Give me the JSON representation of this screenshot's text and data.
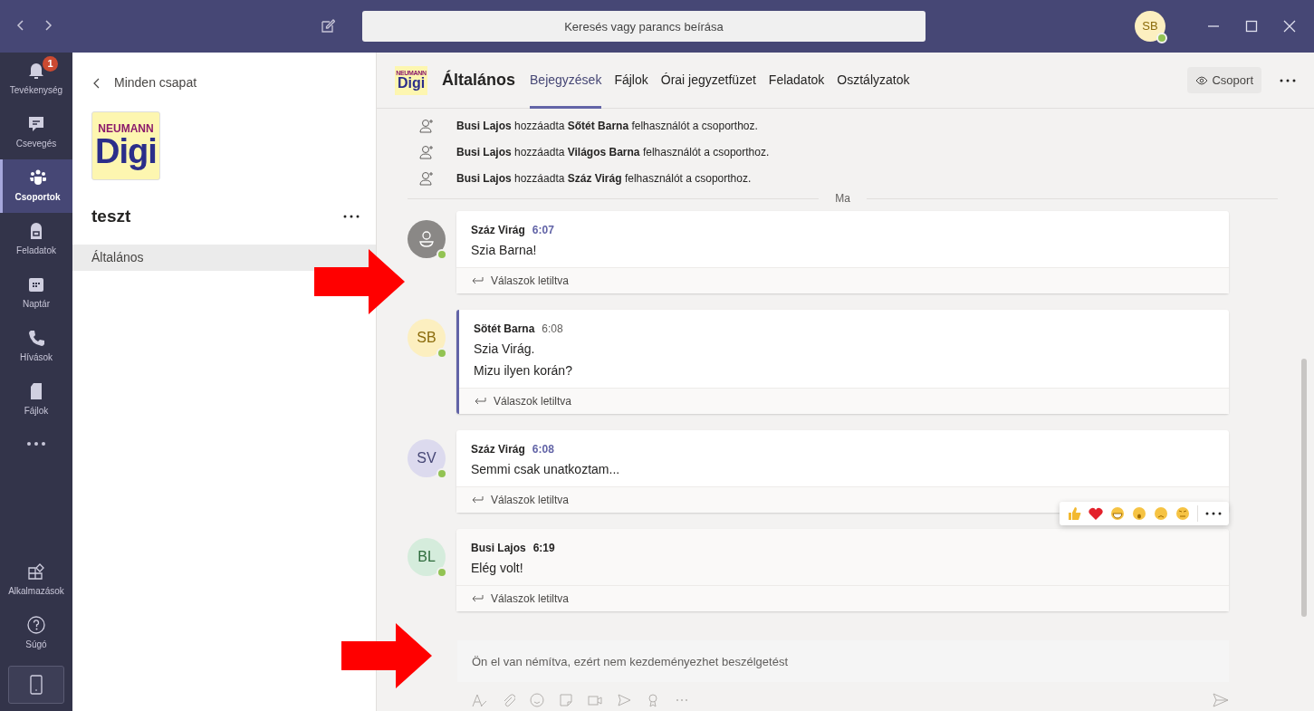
{
  "titlebar": {
    "search_placeholder": "Keresés vagy parancs beírása",
    "user_initials": "SB"
  },
  "rail": [
    {
      "label": "Tevékenység",
      "badge": "1",
      "selected": false
    },
    {
      "label": "Csevegés",
      "selected": false
    },
    {
      "label": "Csoportok",
      "selected": true
    },
    {
      "label": "Feladatok",
      "selected": false
    },
    {
      "label": "Naptár",
      "selected": false
    },
    {
      "label": "Hívások",
      "selected": false
    },
    {
      "label": "Fájlok",
      "selected": false
    }
  ],
  "rail_bottom": [
    {
      "label": "Alkalmazások"
    },
    {
      "label": "Súgó"
    }
  ],
  "team_panel": {
    "back_label": "Minden csapat",
    "logo_top": "NEUMANN",
    "logo_main": "Digi",
    "team_name": "teszt",
    "channels": [
      {
        "name": "Általános",
        "selected": true
      }
    ]
  },
  "channel": {
    "logo_top": "NEUMANN",
    "logo_main": "Digi",
    "name": "Általános",
    "tabs": [
      {
        "label": "Bejegyzések",
        "selected": true
      },
      {
        "label": "Fájlok",
        "selected": false
      },
      {
        "label": "Órai jegyzetfüzet",
        "selected": false
      },
      {
        "label": "Feladatok",
        "selected": false
      },
      {
        "label": "Osztályzatok",
        "selected": false
      }
    ],
    "team_button": "Csoport"
  },
  "activity": [
    "**Busi Lajos** hozzáadta **Sőtét Barna** felhasználót a csoporthoz.",
    "**Busi Lajos** hozzáadta **Világos Barna** felhasználót a csoporthoz.",
    "**Busi Lajos** hozzáadta **Száz Virág** felhasználót a csoporthoz."
  ],
  "day_divider": "Ma",
  "messages": [
    {
      "author": "Száz Virág",
      "time": "6:07",
      "time_highlighted": true,
      "own": false,
      "hovered": false,
      "avatar": {
        "kind": "generic"
      },
      "lines": [
        "Szia Barna!"
      ],
      "reply": "Válaszok letiltva"
    },
    {
      "author": "Sötét Barna",
      "time": "6:08",
      "time_highlighted": false,
      "own": true,
      "hovered": false,
      "avatar": {
        "kind": "initials",
        "initials": "SB",
        "color": "#fcefc0"
      },
      "lines": [
        "Szia Virág.",
        "Mizu ilyen korán?"
      ],
      "reply": "Válaszok letiltva"
    },
    {
      "author": "Száz Virág",
      "time": "6:08",
      "time_highlighted": true,
      "own": false,
      "hovered": false,
      "avatar": {
        "kind": "initials",
        "initials": "SV",
        "color": "#dcdaee"
      },
      "lines": [
        "Semmi csak unatkoztam..."
      ],
      "reply": "Válaszok letiltva"
    },
    {
      "author": "Busi Lajos",
      "time": "6:19",
      "time_highlighted": false,
      "own": false,
      "hovered": true,
      "avatar": {
        "kind": "initials",
        "initials": "BL",
        "color": "#d5ecdc"
      },
      "lines": [
        "Elég volt!"
      ],
      "reply": "Válaszok letiltva"
    }
  ],
  "composer": {
    "placeholder": "Ön el van némítva, ezért nem kezdeményezhet beszélgetést",
    "disabled": true
  }
}
